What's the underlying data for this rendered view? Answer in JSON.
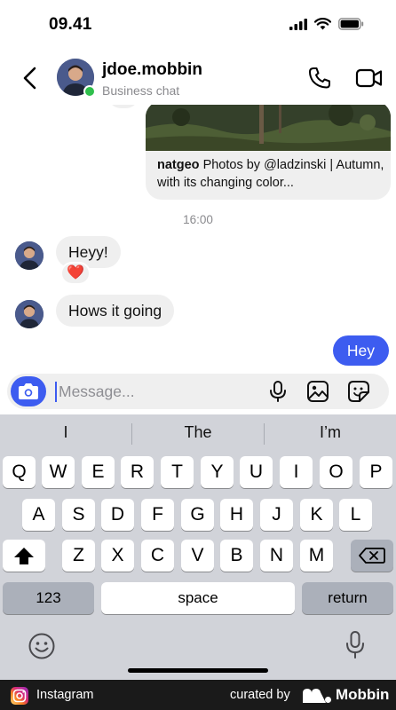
{
  "status_bar": {
    "time": "09.41"
  },
  "header": {
    "username": "jdoe.mobbin",
    "subtitle": "Business chat"
  },
  "shared_post": {
    "author": "natgeo",
    "caption": "Photos by @ladzinski | Autumn, with its changing color..."
  },
  "conversation": {
    "timestamp": "16:00",
    "incoming": [
      {
        "text": "Heyy!",
        "reaction": "❤️"
      },
      {
        "text": "Hows it going"
      }
    ],
    "outgoing": [
      {
        "text": "Hey"
      }
    ]
  },
  "composer": {
    "placeholder": "Message..."
  },
  "keyboard": {
    "suggestions": [
      "I",
      "The",
      "I’m"
    ],
    "row1": [
      "Q",
      "W",
      "E",
      "R",
      "T",
      "Y",
      "U",
      "I",
      "O",
      "P"
    ],
    "row2": [
      "A",
      "S",
      "D",
      "F",
      "G",
      "H",
      "J",
      "K",
      "L"
    ],
    "row3": [
      "Z",
      "X",
      "C",
      "V",
      "B",
      "N",
      "M"
    ],
    "numbers_label": "123",
    "space_label": "space",
    "return_label": "return"
  },
  "footer": {
    "app_name": "Instagram",
    "curated_by": "curated by",
    "brand": "Mobbin"
  },
  "colors": {
    "accent": "#3d5cf0",
    "online": "#2fbf4c",
    "bubble_gray": "#efefef",
    "keyboard_bg": "#d1d3d9"
  },
  "icons": [
    "signal-icon",
    "wifi-icon",
    "battery-icon",
    "back-icon",
    "phone-icon",
    "video-icon",
    "camera-icon",
    "microphone-icon",
    "gallery-icon",
    "sticker-icon",
    "shift-icon",
    "delete-icon",
    "emoji-icon",
    "dictation-icon",
    "instagram-icon",
    "mobbin-logo"
  ]
}
